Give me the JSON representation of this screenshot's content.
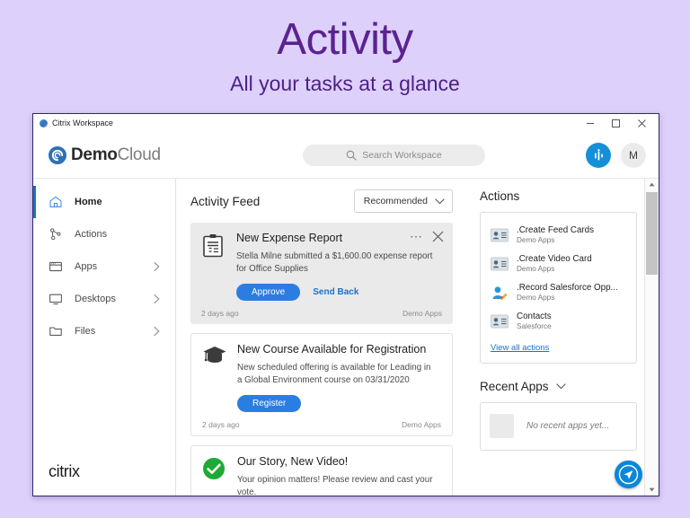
{
  "hero": {
    "title": "Activity",
    "subtitle": "All your tasks at a glance"
  },
  "window": {
    "titlebar_text": "Citrix Workspace",
    "controls": {
      "minimize": "–",
      "maximize": "□",
      "close": "×"
    }
  },
  "header": {
    "brand_bold": "Demo",
    "brand_light": "Cloud",
    "search_placeholder": "Search Workspace",
    "search_value": "",
    "avatar_initial": "M"
  },
  "sidebar": {
    "items": [
      {
        "label": "Home",
        "icon": "home-icon",
        "active": true,
        "chevron": false
      },
      {
        "label": "Actions",
        "icon": "actions-icon",
        "active": false,
        "chevron": false
      },
      {
        "label": "Apps",
        "icon": "apps-icon",
        "active": false,
        "chevron": true
      },
      {
        "label": "Desktops",
        "icon": "desktop-icon",
        "active": false,
        "chevron": true
      },
      {
        "label": "Files",
        "icon": "folder-icon",
        "active": false,
        "chevron": true
      }
    ],
    "footer_logo": "citrix"
  },
  "feed": {
    "title": "Activity Feed",
    "filter_label": "Recommended",
    "cards": [
      {
        "icon": "expense-report-icon",
        "title": "New Expense Report",
        "description": "Stella Milne submitted a $1,600.00 expense report for Office Supplies",
        "primary_action": "Approve",
        "secondary_action": "Send Back",
        "time": "2 days ago",
        "source": "Demo Apps",
        "has_menu": true,
        "has_close": true
      },
      {
        "icon": "graduation-cap-icon",
        "title": "New Course Available for Registration",
        "description": "New scheduled offering is available for Leading in a Global Environment course on 03/31/2020",
        "primary_action": "Register",
        "secondary_action": "",
        "time": "2 days ago",
        "source": "Demo Apps",
        "has_menu": false,
        "has_close": false
      },
      {
        "icon": "green-check-icon",
        "title": "Our Story, New Video!",
        "description": "Your opinion matters! Please review and cast your vote.",
        "primary_action": "",
        "secondary_action": "",
        "time": "",
        "source": "",
        "has_menu": false,
        "has_close": false
      }
    ]
  },
  "actions_panel": {
    "title": "Actions",
    "items": [
      {
        "name": ".Create Feed Cards",
        "source": "Demo Apps",
        "icon": "contact-card-icon"
      },
      {
        "name": ".Create Video Card",
        "source": "Demo Apps",
        "icon": "contact-card-icon"
      },
      {
        "name": ".Record Salesforce Opp...",
        "source": "Demo Apps",
        "icon": "person-edit-icon"
      },
      {
        "name": "Contacts",
        "source": "Salesforce",
        "icon": "contact-card-icon"
      }
    ],
    "view_all_label": "View all actions"
  },
  "recent_apps": {
    "title": "Recent Apps",
    "empty_text": "No recent apps yet..."
  },
  "colors": {
    "page_background": "#ddd0fb",
    "hero_text": "#5b238f",
    "accent_blue": "#2a7de1",
    "link_blue": "#1a73c8",
    "feed_button_blue": "#1590d8",
    "fab_blue": "#0b87d8",
    "success_green": "#1eaa35",
    "card_gray": "#eaeaea"
  }
}
